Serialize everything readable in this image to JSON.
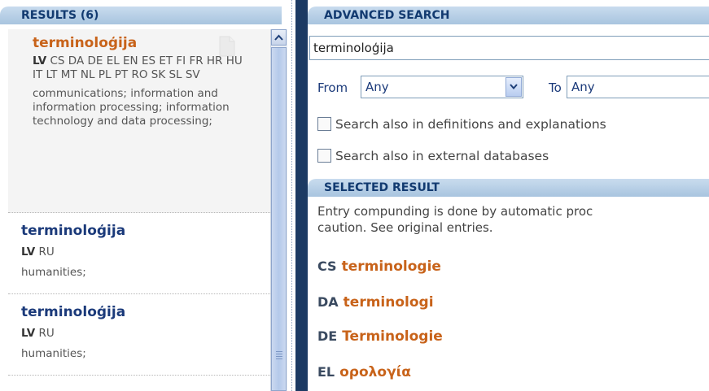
{
  "results_panel": {
    "header": "RESULTS (6)",
    "items": [
      {
        "term": "terminoloģija",
        "lang_primary": "LV",
        "langs": "CS DA DE EL EN ES ET FI FR HR HU IT LT MT NL PL PT RO SK SL SV",
        "domain": "communications; information and information processing; information technology and data processing;"
      },
      {
        "term": "terminoloģija",
        "lang_primary": "LV",
        "langs": "RU",
        "domain": "humanities;"
      },
      {
        "term": "terminoloģija",
        "lang_primary": "LV",
        "langs": "RU",
        "domain": "humanities;"
      }
    ]
  },
  "advanced_search": {
    "header": "ADVANCED SEARCH",
    "query": "terminoloģija",
    "from_label": "From",
    "from_value": "Any",
    "to_label": "To",
    "to_value": "Any",
    "check_definitions": "Search also in definitions and explanations",
    "check_external": "Search also in external databases"
  },
  "selected_result": {
    "header": "SELECTED RESULT",
    "note_line1": "Entry compunding is done by automatic proc",
    "note_line2": "caution. See original entries.",
    "entries": [
      {
        "code": "CS",
        "term": "terminologie"
      },
      {
        "code": "DA",
        "term": "terminologi"
      },
      {
        "code": "DE",
        "term": "Terminologie"
      },
      {
        "code": "EL",
        "term": "ορολογία"
      }
    ]
  }
}
